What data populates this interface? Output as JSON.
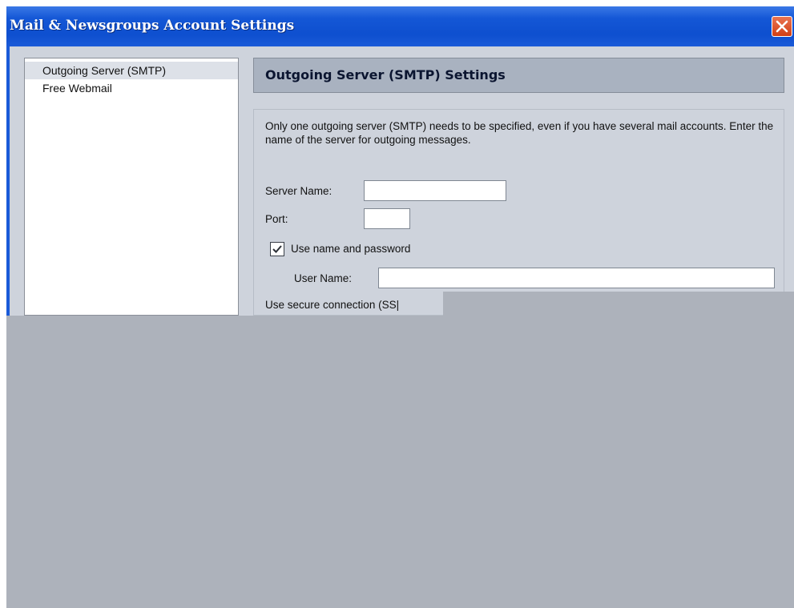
{
  "window": {
    "title": "Mail & Newsgroups Account Settings",
    "close_icon": "close-icon"
  },
  "sidebar": {
    "items": [
      {
        "label": "Outgoing Server (SMTP)",
        "selected": true
      },
      {
        "label": "Free Webmail",
        "selected": false
      }
    ]
  },
  "panel": {
    "header": "Outgoing Server (SMTP) Settings",
    "description": "Only one outgoing server (SMTP) needs to be specified, even if you have several mail accounts. Enter the name of the server for outgoing messages.",
    "server_name_label": "Server Name:",
    "server_name_value": "",
    "port_label": "Port:",
    "port_value": "",
    "use_auth_label": "Use name and password",
    "use_auth_checked": true,
    "user_name_label": "User Name:",
    "user_name_value": "",
    "secure_connection_label": "Use secure connection (SS|"
  },
  "colors": {
    "titlebar": "#1457d6",
    "close_button": "#d23f14",
    "panel_header_bg": "#a9b2c0",
    "content_bg": "#ced3dc",
    "overlay": "#adb2bb"
  }
}
